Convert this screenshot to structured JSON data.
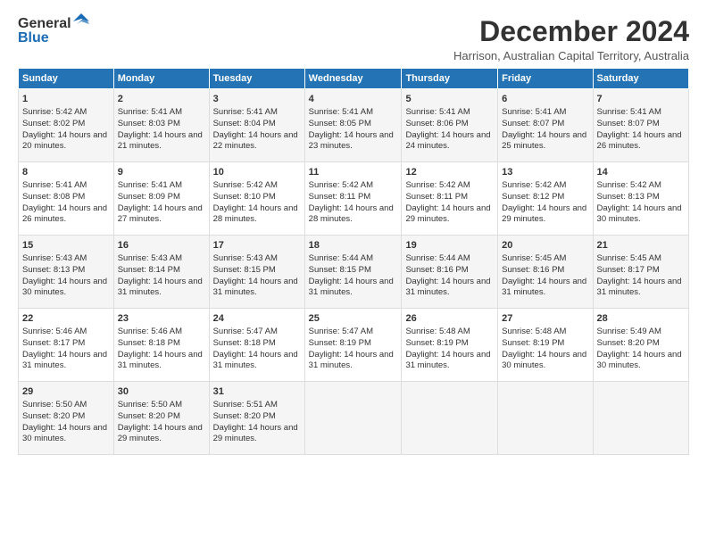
{
  "header": {
    "logo_general": "General",
    "logo_blue": "Blue",
    "month_title": "December 2024",
    "location": "Harrison, Australian Capital Territory, Australia"
  },
  "days_header": [
    "Sunday",
    "Monday",
    "Tuesday",
    "Wednesday",
    "Thursday",
    "Friday",
    "Saturday"
  ],
  "weeks": [
    [
      {
        "day": "1",
        "sunrise": "Sunrise: 5:42 AM",
        "sunset": "Sunset: 8:02 PM",
        "daylight": "Daylight: 14 hours and 20 minutes."
      },
      {
        "day": "2",
        "sunrise": "Sunrise: 5:41 AM",
        "sunset": "Sunset: 8:03 PM",
        "daylight": "Daylight: 14 hours and 21 minutes."
      },
      {
        "day": "3",
        "sunrise": "Sunrise: 5:41 AM",
        "sunset": "Sunset: 8:04 PM",
        "daylight": "Daylight: 14 hours and 22 minutes."
      },
      {
        "day": "4",
        "sunrise": "Sunrise: 5:41 AM",
        "sunset": "Sunset: 8:05 PM",
        "daylight": "Daylight: 14 hours and 23 minutes."
      },
      {
        "day": "5",
        "sunrise": "Sunrise: 5:41 AM",
        "sunset": "Sunset: 8:06 PM",
        "daylight": "Daylight: 14 hours and 24 minutes."
      },
      {
        "day": "6",
        "sunrise": "Sunrise: 5:41 AM",
        "sunset": "Sunset: 8:07 PM",
        "daylight": "Daylight: 14 hours and 25 minutes."
      },
      {
        "day": "7",
        "sunrise": "Sunrise: 5:41 AM",
        "sunset": "Sunset: 8:07 PM",
        "daylight": "Daylight: 14 hours and 26 minutes."
      }
    ],
    [
      {
        "day": "8",
        "sunrise": "Sunrise: 5:41 AM",
        "sunset": "Sunset: 8:08 PM",
        "daylight": "Daylight: 14 hours and 26 minutes."
      },
      {
        "day": "9",
        "sunrise": "Sunrise: 5:41 AM",
        "sunset": "Sunset: 8:09 PM",
        "daylight": "Daylight: 14 hours and 27 minutes."
      },
      {
        "day": "10",
        "sunrise": "Sunrise: 5:42 AM",
        "sunset": "Sunset: 8:10 PM",
        "daylight": "Daylight: 14 hours and 28 minutes."
      },
      {
        "day": "11",
        "sunrise": "Sunrise: 5:42 AM",
        "sunset": "Sunset: 8:11 PM",
        "daylight": "Daylight: 14 hours and 28 minutes."
      },
      {
        "day": "12",
        "sunrise": "Sunrise: 5:42 AM",
        "sunset": "Sunset: 8:11 PM",
        "daylight": "Daylight: 14 hours and 29 minutes."
      },
      {
        "day": "13",
        "sunrise": "Sunrise: 5:42 AM",
        "sunset": "Sunset: 8:12 PM",
        "daylight": "Daylight: 14 hours and 29 minutes."
      },
      {
        "day": "14",
        "sunrise": "Sunrise: 5:42 AM",
        "sunset": "Sunset: 8:13 PM",
        "daylight": "Daylight: 14 hours and 30 minutes."
      }
    ],
    [
      {
        "day": "15",
        "sunrise": "Sunrise: 5:43 AM",
        "sunset": "Sunset: 8:13 PM",
        "daylight": "Daylight: 14 hours and 30 minutes."
      },
      {
        "day": "16",
        "sunrise": "Sunrise: 5:43 AM",
        "sunset": "Sunset: 8:14 PM",
        "daylight": "Daylight: 14 hours and 31 minutes."
      },
      {
        "day": "17",
        "sunrise": "Sunrise: 5:43 AM",
        "sunset": "Sunset: 8:15 PM",
        "daylight": "Daylight: 14 hours and 31 minutes."
      },
      {
        "day": "18",
        "sunrise": "Sunrise: 5:44 AM",
        "sunset": "Sunset: 8:15 PM",
        "daylight": "Daylight: 14 hours and 31 minutes."
      },
      {
        "day": "19",
        "sunrise": "Sunrise: 5:44 AM",
        "sunset": "Sunset: 8:16 PM",
        "daylight": "Daylight: 14 hours and 31 minutes."
      },
      {
        "day": "20",
        "sunrise": "Sunrise: 5:45 AM",
        "sunset": "Sunset: 8:16 PM",
        "daylight": "Daylight: 14 hours and 31 minutes."
      },
      {
        "day": "21",
        "sunrise": "Sunrise: 5:45 AM",
        "sunset": "Sunset: 8:17 PM",
        "daylight": "Daylight: 14 hours and 31 minutes."
      }
    ],
    [
      {
        "day": "22",
        "sunrise": "Sunrise: 5:46 AM",
        "sunset": "Sunset: 8:17 PM",
        "daylight": "Daylight: 14 hours and 31 minutes."
      },
      {
        "day": "23",
        "sunrise": "Sunrise: 5:46 AM",
        "sunset": "Sunset: 8:18 PM",
        "daylight": "Daylight: 14 hours and 31 minutes."
      },
      {
        "day": "24",
        "sunrise": "Sunrise: 5:47 AM",
        "sunset": "Sunset: 8:18 PM",
        "daylight": "Daylight: 14 hours and 31 minutes."
      },
      {
        "day": "25",
        "sunrise": "Sunrise: 5:47 AM",
        "sunset": "Sunset: 8:19 PM",
        "daylight": "Daylight: 14 hours and 31 minutes."
      },
      {
        "day": "26",
        "sunrise": "Sunrise: 5:48 AM",
        "sunset": "Sunset: 8:19 PM",
        "daylight": "Daylight: 14 hours and 31 minutes."
      },
      {
        "day": "27",
        "sunrise": "Sunrise: 5:48 AM",
        "sunset": "Sunset: 8:19 PM",
        "daylight": "Daylight: 14 hours and 30 minutes."
      },
      {
        "day": "28",
        "sunrise": "Sunrise: 5:49 AM",
        "sunset": "Sunset: 8:20 PM",
        "daylight": "Daylight: 14 hours and 30 minutes."
      }
    ],
    [
      {
        "day": "29",
        "sunrise": "Sunrise: 5:50 AM",
        "sunset": "Sunset: 8:20 PM",
        "daylight": "Daylight: 14 hours and 30 minutes."
      },
      {
        "day": "30",
        "sunrise": "Sunrise: 5:50 AM",
        "sunset": "Sunset: 8:20 PM",
        "daylight": "Daylight: 14 hours and 29 minutes."
      },
      {
        "day": "31",
        "sunrise": "Sunrise: 5:51 AM",
        "sunset": "Sunset: 8:20 PM",
        "daylight": "Daylight: 14 hours and 29 minutes."
      },
      null,
      null,
      null,
      null
    ]
  ]
}
